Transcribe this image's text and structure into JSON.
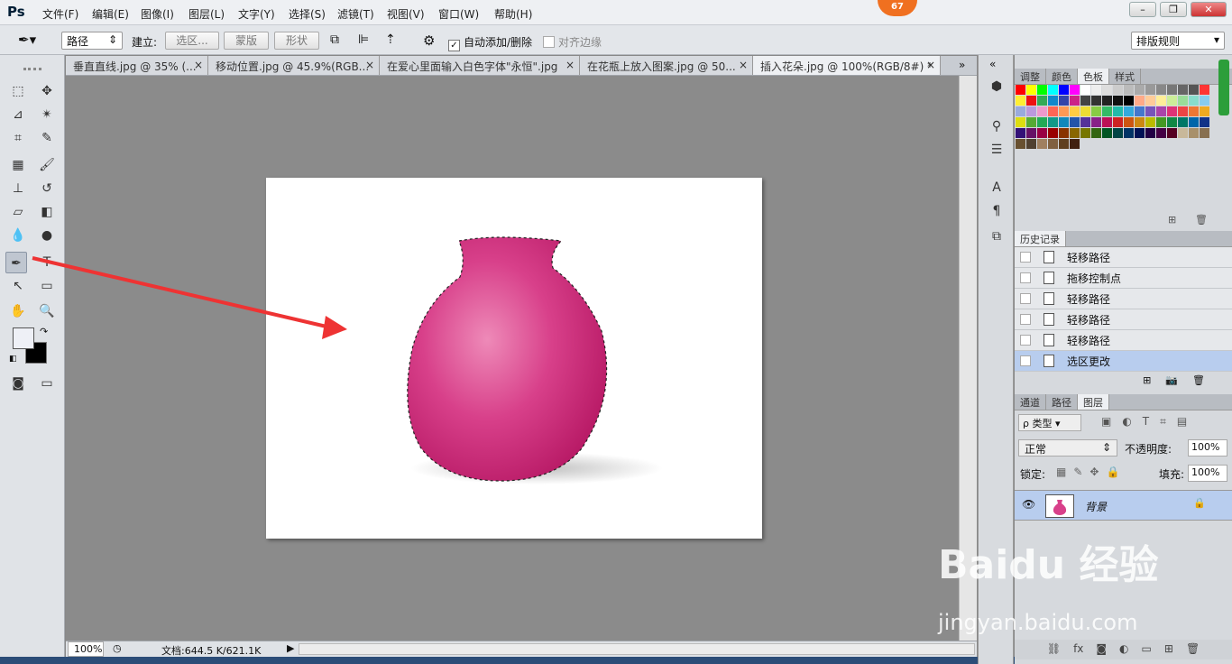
{
  "app": {
    "logo": "Ps",
    "notification_badge": "67"
  },
  "menu": [
    "文件(F)",
    "编辑(E)",
    "图像(I)",
    "图层(L)",
    "文字(Y)",
    "选择(S)",
    "滤镜(T)",
    "视图(V)",
    "窗口(W)",
    "帮助(H)"
  ],
  "options": {
    "mode_select": "路径",
    "make_label": "建立:",
    "selection_btn": "选区...",
    "mask_btn": "蒙版",
    "shape_btn": "形状",
    "auto_add_label": "自动添加/删除",
    "auto_add_checked": true,
    "align_edges_label": "对齐边缘",
    "align_edges_checked": false,
    "workspace_select": "排版规则"
  },
  "tabs": [
    {
      "label": "垂直直线.jpg @ 35% (...",
      "active": false
    },
    {
      "label": "移动位置.jpg @ 45.9%(RGB...",
      "active": false
    },
    {
      "label": "在爱心里面输入白色字体\"永恒\".jpg",
      "active": false
    },
    {
      "label": "在花瓶上放入图案.jpg @ 50...",
      "active": false
    },
    {
      "label": "插入花朵.jpg @ 100%(RGB/8#) *",
      "active": true
    }
  ],
  "status": {
    "zoom": "100%",
    "doc_info": "文档:644.5 K/621.1K"
  },
  "swatch_panel": {
    "tabs": [
      "调整",
      "颜色",
      "色板",
      "样式"
    ],
    "active": "色板"
  },
  "history_panel": {
    "title": "历史记录",
    "items": [
      {
        "label": "轻移路径",
        "selected": false
      },
      {
        "label": "拖移控制点",
        "selected": false
      },
      {
        "label": "轻移路径",
        "selected": false
      },
      {
        "label": "轻移路径",
        "selected": false
      },
      {
        "label": "轻移路径",
        "selected": false
      },
      {
        "label": "选区更改",
        "selected": true
      }
    ]
  },
  "layers_panel": {
    "tabs": [
      "通道",
      "路径",
      "图层"
    ],
    "active": "图层",
    "filter_label": "ρ 类型",
    "blend_mode": "正常",
    "opacity_label": "不透明度:",
    "opacity_value": "100%",
    "lock_label": "锁定:",
    "fill_label": "填充:",
    "fill_value": "100%",
    "layers": [
      {
        "name": "背景",
        "locked": true,
        "visible": true
      }
    ]
  },
  "watermark": {
    "main": "Baidu 经验",
    "url": "jingyan.baidu.com"
  },
  "colors": {
    "accent": "#e0307a",
    "selection": "#b8cdee",
    "arrow": "#ee3333"
  }
}
